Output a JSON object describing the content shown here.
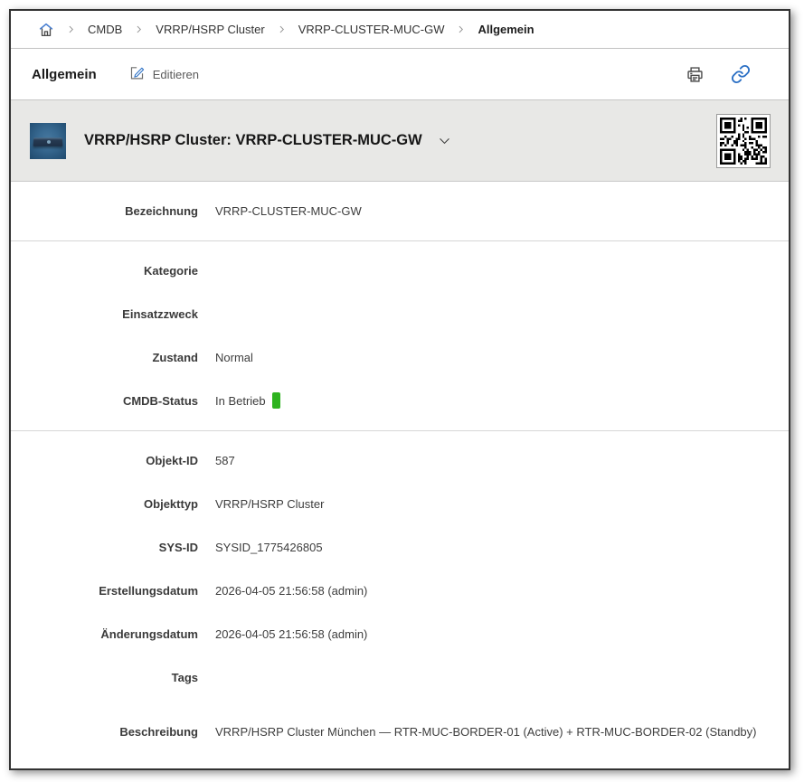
{
  "colors": {
    "accent_blue": "#2a6fc4",
    "status_green": "#2eb31f",
    "object_band_bg": "#e8e8e6",
    "window_border": "#333333"
  },
  "breadcrumb": {
    "items": [
      {
        "label": "CMDB"
      },
      {
        "label": "VRRP/HSRP Cluster"
      },
      {
        "label": "VRRP-CLUSTER-MUC-GW"
      },
      {
        "label": "Allgemein"
      }
    ]
  },
  "header": {
    "title": "Allgemein",
    "edit_label": "Editieren"
  },
  "object_header": {
    "title": "VRRP/HSRP Cluster: VRRP-CLUSTER-MUC-GW"
  },
  "sections": [
    {
      "rows": [
        {
          "label": "Bezeichnung",
          "value": "VRRP-CLUSTER-MUC-GW"
        }
      ]
    },
    {
      "rows": [
        {
          "label": "Kategorie",
          "value": ""
        },
        {
          "label": "Einsatzzweck",
          "value": ""
        },
        {
          "label": "Zustand",
          "value": "Normal"
        },
        {
          "label": "CMDB-Status",
          "value": "In Betrieb",
          "badge": "green"
        }
      ]
    },
    {
      "rows": [
        {
          "label": "Objekt-ID",
          "value": "587"
        },
        {
          "label": "Objekttyp",
          "value": "VRRP/HSRP Cluster"
        },
        {
          "label": "SYS-ID",
          "value": "SYSID_1775426805"
        },
        {
          "label": "Erstellungsdatum",
          "value": "2026-04-05 21:56:58 (admin)"
        },
        {
          "label": "Änderungsdatum",
          "value": "2026-04-05 21:56:58 (admin)"
        },
        {
          "label": "Tags",
          "value": ""
        },
        {
          "label": "Beschreibung",
          "value": "VRRP/HSRP Cluster München — RTR-MUC-BORDER-01 (Active) + RTR-MUC-BORDER-02 (Standby)"
        }
      ]
    }
  ]
}
